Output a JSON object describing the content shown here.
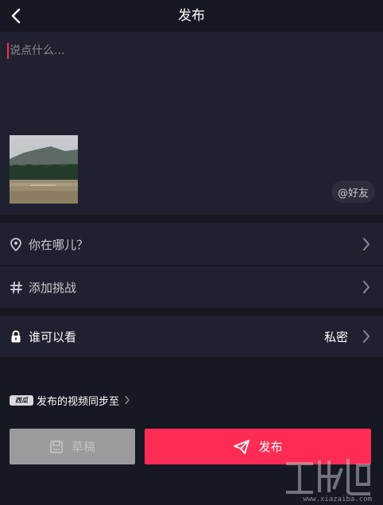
{
  "header": {
    "title": "发布",
    "back_icon": "chevron-left-icon"
  },
  "compose": {
    "placeholder": "说点什么...",
    "at_friends_label": "@好友",
    "cursor_color": "#fe2c55"
  },
  "options": {
    "location_label": "你在哪儿？",
    "challenge_label": "添加挑战",
    "privacy_label": "谁可以看",
    "privacy_value": "私密"
  },
  "sync": {
    "logo_text": "西瓜",
    "label": "发布的视频同步至"
  },
  "actions": {
    "draft_label": "草稿",
    "publish_label": "发布"
  },
  "watermark": {
    "url": "www.xiazaiba.com"
  },
  "colors": {
    "background": "#161823",
    "panel": "#1f2130",
    "accent": "#fe2c55",
    "draft_button": "#9b9b9f"
  }
}
